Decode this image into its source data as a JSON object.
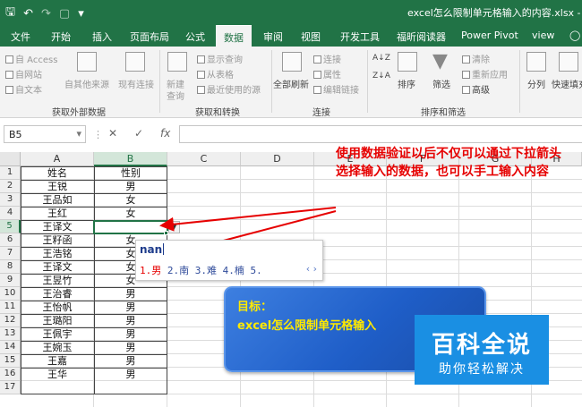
{
  "window": {
    "title": "excel怎么限制单元格输入的内容.xlsx - Exce"
  },
  "quick_access": {
    "save_icon": "save-icon",
    "undo_icon": "undo-icon",
    "redo_icon": "redo-icon",
    "format_icon": "format-icon",
    "customize_icon": "customize-icon"
  },
  "tabs": [
    {
      "label": "文件"
    },
    {
      "label": "开始"
    },
    {
      "label": "插入"
    },
    {
      "label": "页面布局"
    },
    {
      "label": "公式"
    },
    {
      "label": "数据",
      "active": true
    },
    {
      "label": "审阅"
    },
    {
      "label": "视图"
    },
    {
      "label": "开发工具"
    },
    {
      "label": "福昕阅读器"
    },
    {
      "label": "Power Pivot"
    },
    {
      "label": "view"
    }
  ],
  "ribbon": {
    "external": {
      "access": "自 Access",
      "web": "自网站",
      "text": "自文本",
      "other": "自其他来源",
      "existing": "现有连接",
      "group": "获取外部数据"
    },
    "transform": {
      "new_query_1": "新建",
      "new_query_2": "查询",
      "show_queries": "显示查询",
      "from_table": "从表格",
      "recent": "最近使用的源",
      "group": "获取和转换"
    },
    "connections": {
      "refresh_all": "全部刷新",
      "connections": "连接",
      "properties": "属性",
      "edit_links": "编辑链接",
      "group": "连接"
    },
    "sort_filter": {
      "sort_az": "A↓Z",
      "sort_za": "Z↓A",
      "sort": "排序",
      "filter": "筛选",
      "clear": "清除",
      "reapply": "重新应用",
      "advanced": "高级",
      "group": "排序和筛选"
    },
    "tools": {
      "split": "分列",
      "flash_fill": "快速填充"
    },
    "accent": "#217346"
  },
  "formula_bar": {
    "name_box": "B5",
    "cancel": "✕",
    "enter": "✓",
    "fx": "fx",
    "value": ""
  },
  "columns": [
    "A",
    "B",
    "C",
    "D",
    "E",
    "F",
    "G",
    "H"
  ],
  "rows": [
    {
      "n": "1",
      "a": "姓名",
      "b": "性别"
    },
    {
      "n": "2",
      "a": "王锐",
      "b": "男"
    },
    {
      "n": "3",
      "a": "王品如",
      "b": "女"
    },
    {
      "n": "4",
      "a": "王红",
      "b": "女"
    },
    {
      "n": "5",
      "a": "王译文",
      "b": ""
    },
    {
      "n": "6",
      "a": "王籽函",
      "b": "女"
    },
    {
      "n": "7",
      "a": "王浩铭",
      "b": "女"
    },
    {
      "n": "8",
      "a": "王译文",
      "b": "女"
    },
    {
      "n": "9",
      "a": "王昱竹",
      "b": "女"
    },
    {
      "n": "10",
      "a": "王治睿",
      "b": "男"
    },
    {
      "n": "11",
      "a": "王怡帆",
      "b": "男"
    },
    {
      "n": "12",
      "a": "王璐阳",
      "b": "男"
    },
    {
      "n": "13",
      "a": "王佩宇",
      "b": "男"
    },
    {
      "n": "14",
      "a": "王婉玉",
      "b": "男"
    },
    {
      "n": "15",
      "a": "王嘉",
      "b": "男"
    },
    {
      "n": "16",
      "a": "王华",
      "b": "男"
    },
    {
      "n": "17",
      "a": "",
      "b": ""
    }
  ],
  "active_cell": "B5",
  "annotation": "使用数据验证以后不仅可以通过下拉箭头选择输入的数据，也可以手工输入内容",
  "ime": {
    "input": "nan",
    "candidate_first": "1.男",
    "candidates_rest": " 2.南 3.难 4.楠 5.",
    "nav": "‹ ›"
  },
  "goal": {
    "label": "目标：",
    "text": "excel怎么限制单元格输入"
  },
  "watermark": {
    "logo": "百科全说",
    "sub": "助你轻松解决"
  }
}
